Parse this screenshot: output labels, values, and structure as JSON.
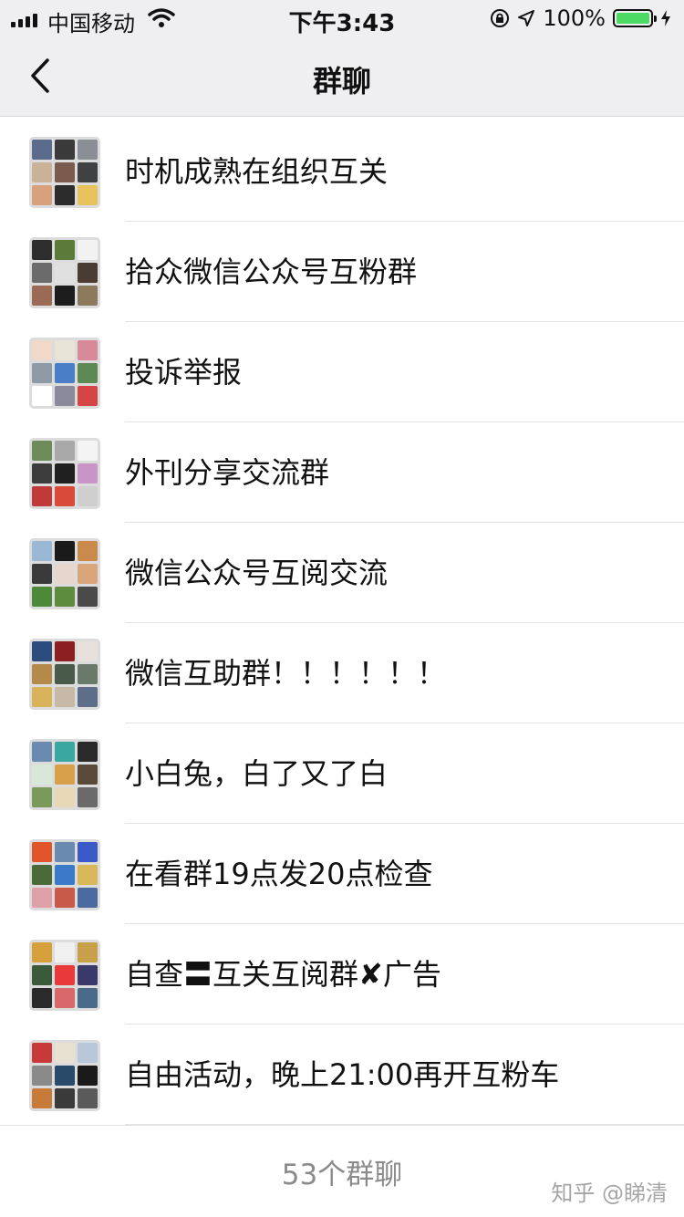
{
  "status_bar": {
    "carrier": "中国移动",
    "time": "下午3:43",
    "battery": "100%",
    "battery_color": "#4cd964"
  },
  "nav": {
    "back_icon": "chevron-left-icon",
    "title": "群聊"
  },
  "groups": [
    {
      "name": "时机成熟在组织互关",
      "avatar_colors": [
        "#5a6b8c",
        "#3a3a3a",
        "#8a8e96",
        "#c9b19a",
        "#7b5b4e",
        "#3f4142",
        "#d9a07c",
        "#2c2c2c",
        "#e8c25d"
      ]
    },
    {
      "name": "拾众微信公众号互粉群",
      "avatar_colors": [
        "#2e2e2e",
        "#5c7a3a",
        "#f2f2f2",
        "#6b6b6b",
        "#e0e0e0",
        "#4a3c33",
        "#9a6a55",
        "#1d1d1d",
        "#8c7a5c"
      ]
    },
    {
      "name": "投诉举报",
      "avatar_colors": [
        "#f1d9c9",
        "#e9e4d8",
        "#d98a9a",
        "#8e9aa6",
        "#4a7ec6",
        "#5d8a54",
        "#ffffff",
        "#8a8a9c",
        "#d64545"
      ]
    },
    {
      "name": "外刊分享交流群",
      "avatar_colors": [
        "#6d8c5a",
        "#a8a8a8",
        "#f4f4f4",
        "#3c3c3c",
        "#202020",
        "#c995c6",
        "#c03a3a",
        "#d94a3a",
        "#cfcfcf"
      ]
    },
    {
      "name": "微信公众号互阅交流",
      "avatar_colors": [
        "#9ab8d6",
        "#1a1a1a",
        "#c98a4c",
        "#3a3a3a",
        "#e6d6cc",
        "#d8a67a",
        "#4c8a3a",
        "#5d8c3e",
        "#4a4a4a"
      ]
    },
    {
      "name": "微信互助群！！！！！！",
      "avatar_colors": [
        "#2b4c7c",
        "#8c1f1f",
        "#e8e0da",
        "#b38a4a",
        "#4a5a4a",
        "#6a7a6a",
        "#d8b35a",
        "#c8b8a8",
        "#5d6d8a"
      ]
    },
    {
      "name": "小白兔，白了又了白",
      "avatar_colors": [
        "#6a8ab0",
        "#3aa8a0",
        "#2a2a2a",
        "#d8e8d8",
        "#d8a04a",
        "#5a4a3a",
        "#7a9a5a",
        "#e8d8b8",
        "#6a6a6a"
      ]
    },
    {
      "name": "在看群19点发20点检查",
      "avatar_colors": [
        "#e0562a",
        "#6a8ab0",
        "#3a5ac8",
        "#4a6a3a",
        "#3a7ac8",
        "#d8b85a",
        "#e0a0a8",
        "#c85a4a",
        "#4a6aa0"
      ]
    },
    {
      "name": "自查〓互关互阅群✘广告",
      "avatar_colors": [
        "#d8a03a",
        "#f0f0f0",
        "#c8a04a",
        "#3a5a3a",
        "#e83a3a",
        "#3a3a6a",
        "#2a2a2a",
        "#d8686a",
        "#4a6a8a"
      ]
    },
    {
      "name": "自由活动，晚上21:00再开互粉车",
      "avatar_colors": [
        "#c83a3a",
        "#e8e0d0",
        "#b8c8d8",
        "#8a8a8a",
        "#2a4a6a",
        "#1a1a1a",
        "#c87a3a",
        "#3a3a3a",
        "#5a5a5a"
      ]
    }
  ],
  "footer": {
    "count": "53个群聊"
  },
  "watermark": "知乎 @睇清"
}
